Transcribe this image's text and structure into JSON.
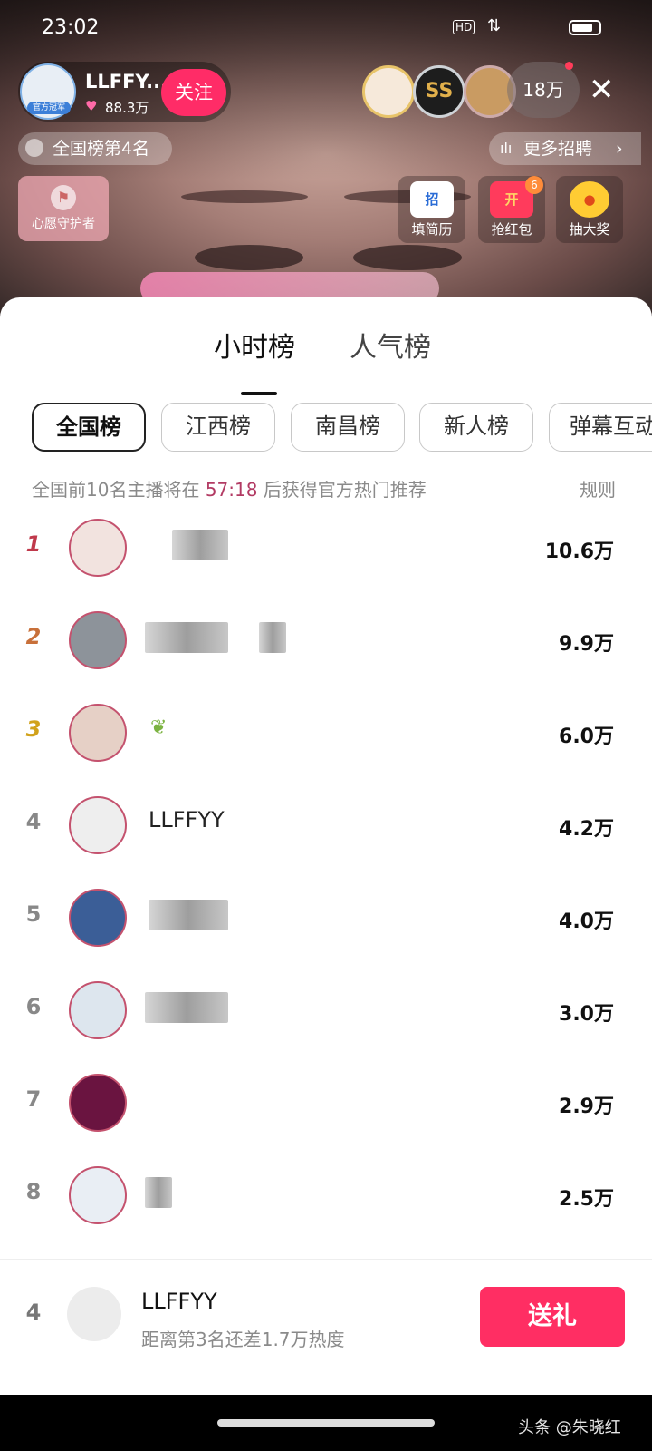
{
  "status_bar": {
    "time": "23:02",
    "hd_badge": "HD"
  },
  "host": {
    "name": "LLFFY...",
    "fans": "88.3万",
    "badge": "官方冠军",
    "follow_label": "关注"
  },
  "viewers": {
    "count": "18万"
  },
  "rank_badge": {
    "label": "全国榜第4名"
  },
  "recruit": {
    "label": "更多招聘"
  },
  "wish_guard": {
    "label": "心愿守护者"
  },
  "activities": [
    {
      "label": "填简历",
      "icon_text": "招"
    },
    {
      "label": "抢红包",
      "icon_text": "开",
      "count": "6"
    },
    {
      "label": "抽大奖"
    }
  ],
  "tabs": [
    {
      "label": "小时榜"
    },
    {
      "label": "人气榜"
    }
  ],
  "filters": [
    {
      "label": "全国榜"
    },
    {
      "label": "江西榜"
    },
    {
      "label": "南昌榜"
    },
    {
      "label": "新人榜"
    },
    {
      "label": "弹幕互动"
    }
  ],
  "notice": {
    "prefix": "全国前10名主播将在",
    "countdown": "57:18",
    "suffix": "后获得官方热门推荐",
    "rules_label": "规则"
  },
  "leaderboard": [
    {
      "rank": "1",
      "name": "",
      "score": "10.6万"
    },
    {
      "rank": "2",
      "name": "",
      "score": "9.9万"
    },
    {
      "rank": "3",
      "name": "",
      "score": "6.0万"
    },
    {
      "rank": "4",
      "name": "LLFFYY",
      "score": "4.2万"
    },
    {
      "rank": "5",
      "name": "",
      "score": "4.0万"
    },
    {
      "rank": "6",
      "name": "",
      "score": "3.0万"
    },
    {
      "rank": "7",
      "name": "",
      "score": "2.9万"
    },
    {
      "rank": "8",
      "name": "",
      "score": "2.5万"
    }
  ],
  "footer": {
    "rank": "4",
    "name": "LLFFYY",
    "gap_text": "距离第3名还差1.7万热度",
    "gift_label": "送礼"
  },
  "watermark": "头条 @朱晓红",
  "colors": {
    "accent": "#ff2e63",
    "countdown": "#b23a63"
  }
}
